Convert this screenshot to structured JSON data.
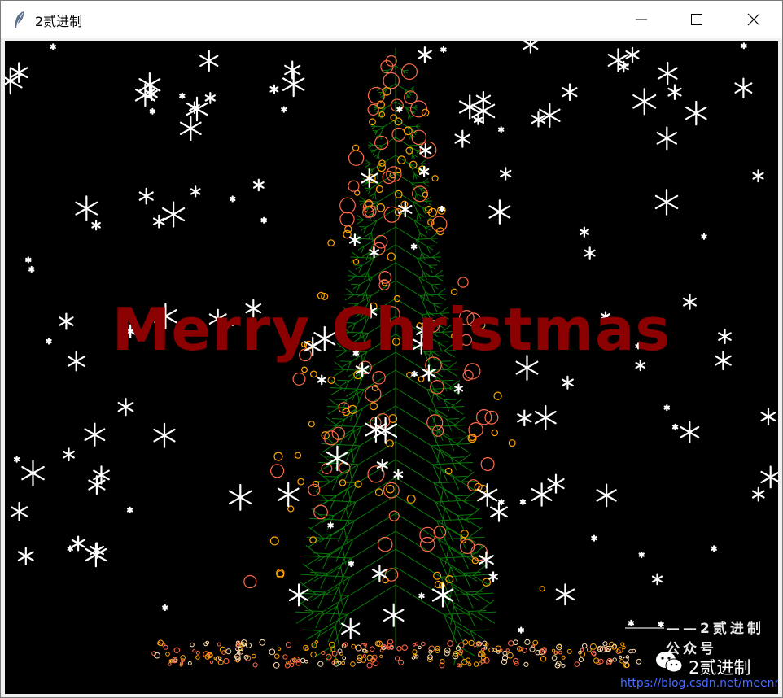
{
  "window": {
    "title": "2贰进制",
    "controls": [
      "minimize",
      "maximize",
      "close"
    ]
  },
  "canvas": {
    "background": "#000000",
    "greeting": "Merry Christmas",
    "greeting_color": "#8b0000",
    "signature": "——2贰进制公众号",
    "tree_color": "#0a7a0a",
    "ornament_colors": [
      "#ff6b4a",
      "#ffa500",
      "#ffe0b0",
      "#ffffff"
    ]
  },
  "watermark": {
    "icon": "wechat-icon",
    "name": "2贰进制",
    "url": "https://blog.csdn.net/meenr"
  }
}
